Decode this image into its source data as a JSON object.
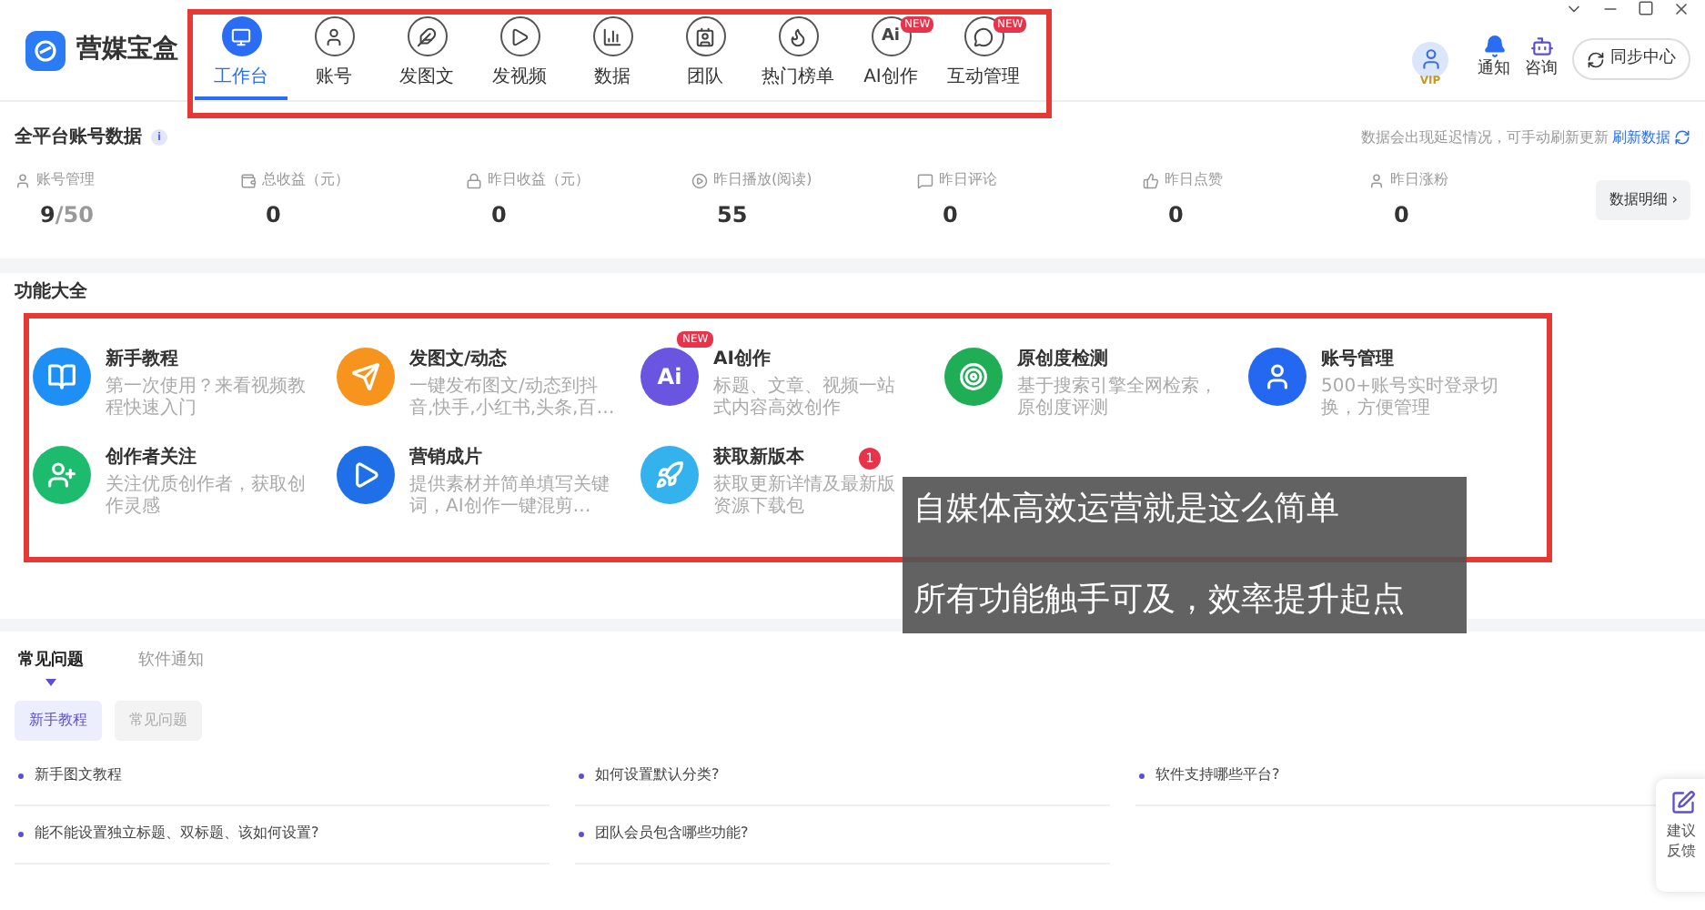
{
  "app": {
    "name": "营媒宝盒"
  },
  "nav": [
    {
      "label": "工作台",
      "kind": "monitor",
      "selected": true
    },
    {
      "label": "账号",
      "kind": "user",
      "selected": false
    },
    {
      "label": "发图文",
      "kind": "feather",
      "selected": false
    },
    {
      "label": "发视频",
      "kind": "play",
      "selected": false
    },
    {
      "label": "数据",
      "kind": "chart",
      "selected": false
    },
    {
      "label": "团队",
      "kind": "team",
      "selected": false
    },
    {
      "label": "热门榜单",
      "kind": "flame",
      "selected": false
    },
    {
      "label": "AI创作",
      "kind": "ai",
      "icon_text": "Ai",
      "badge": "NEW",
      "selected": false
    },
    {
      "label": "互动管理",
      "kind": "chat",
      "badge": "NEW",
      "selected": false
    }
  ],
  "header_right": {
    "vip_badge": "VIP",
    "notify": "通知",
    "consult": "咨询",
    "sync": "同步中心"
  },
  "account_data": {
    "title": "全平台账号数据",
    "info_mark": "i",
    "note": "数据会出现延迟情况，可手动刷新更新",
    "refresh": "刷新数据",
    "detail_button": "数据明细 ›",
    "stats": [
      {
        "label": "账号管理",
        "kind": "user",
        "value": "9",
        "total": "/50"
      },
      {
        "label": "总收益（元）",
        "kind": "wallet",
        "value": "0"
      },
      {
        "label": "昨日收益（元）",
        "kind": "lock",
        "value": "0"
      },
      {
        "label": "昨日播放(阅读)",
        "kind": "play",
        "value": "55"
      },
      {
        "label": "昨日评论",
        "kind": "comment",
        "value": "0"
      },
      {
        "label": "昨日点赞",
        "kind": "like",
        "value": "0"
      },
      {
        "label": "昨日涨粉",
        "kind": "user",
        "value": "0"
      }
    ]
  },
  "features": {
    "title": "功能大全",
    "items": [
      {
        "title": "新手教程",
        "desc": "第一次使用？来看视频教程快速入门",
        "kind": "book",
        "color": "#1e90f5"
      },
      {
        "title": "发图文/动态",
        "desc": "一键发布图文/动态到抖音,快手,小红书,头条,百…",
        "kind": "send",
        "color": "#f7941d"
      },
      {
        "title": "AI创作",
        "desc": "标题、文章、视频一站式内容高效创作",
        "kind": "ai",
        "icon_text": "Ai",
        "badge": "NEW",
        "color": "#6a55e0"
      },
      {
        "title": "原创度检测",
        "desc": "基于搜索引擎全网检索，原创度评测",
        "kind": "target",
        "color": "#1fae55"
      },
      {
        "title": "账号管理",
        "desc": "500+账号实时登录切换，方便管理",
        "kind": "person",
        "color": "#2468f2"
      },
      {
        "title": "创作者关注",
        "desc": "关注优质创作者，获取创作灵感",
        "kind": "user-plus",
        "color": "#1dbb6e"
      },
      {
        "title": "营销成片",
        "desc": "提供素材并简单填写关键词，AI创作一键混剪…",
        "kind": "play",
        "color": "#1f6fe8"
      },
      {
        "title": "获取新版本",
        "desc": "获取更新详情及最新版资源下载包",
        "kind": "rocket",
        "color": "#33b2ee",
        "count": "1"
      }
    ]
  },
  "caption": [
    "自媒体高效运营就是这么简单",
    "所有功能触手可及，效率提升起点"
  ],
  "help": {
    "tabs": [
      {
        "label": "常见问题",
        "selected": true
      },
      {
        "label": "软件通知",
        "selected": false
      }
    ],
    "chips": [
      {
        "label": "新手教程",
        "selected": true
      },
      {
        "label": "常见问题",
        "selected": false
      }
    ],
    "questions": [
      "新手图文教程",
      "如何设置默认分类?",
      "软件支持哪些平台?",
      "能不能设置独立标题、双标题、该如何设置?",
      "团队会员包含哪些功能?"
    ]
  },
  "feedback": {
    "label": "建议反馈"
  }
}
